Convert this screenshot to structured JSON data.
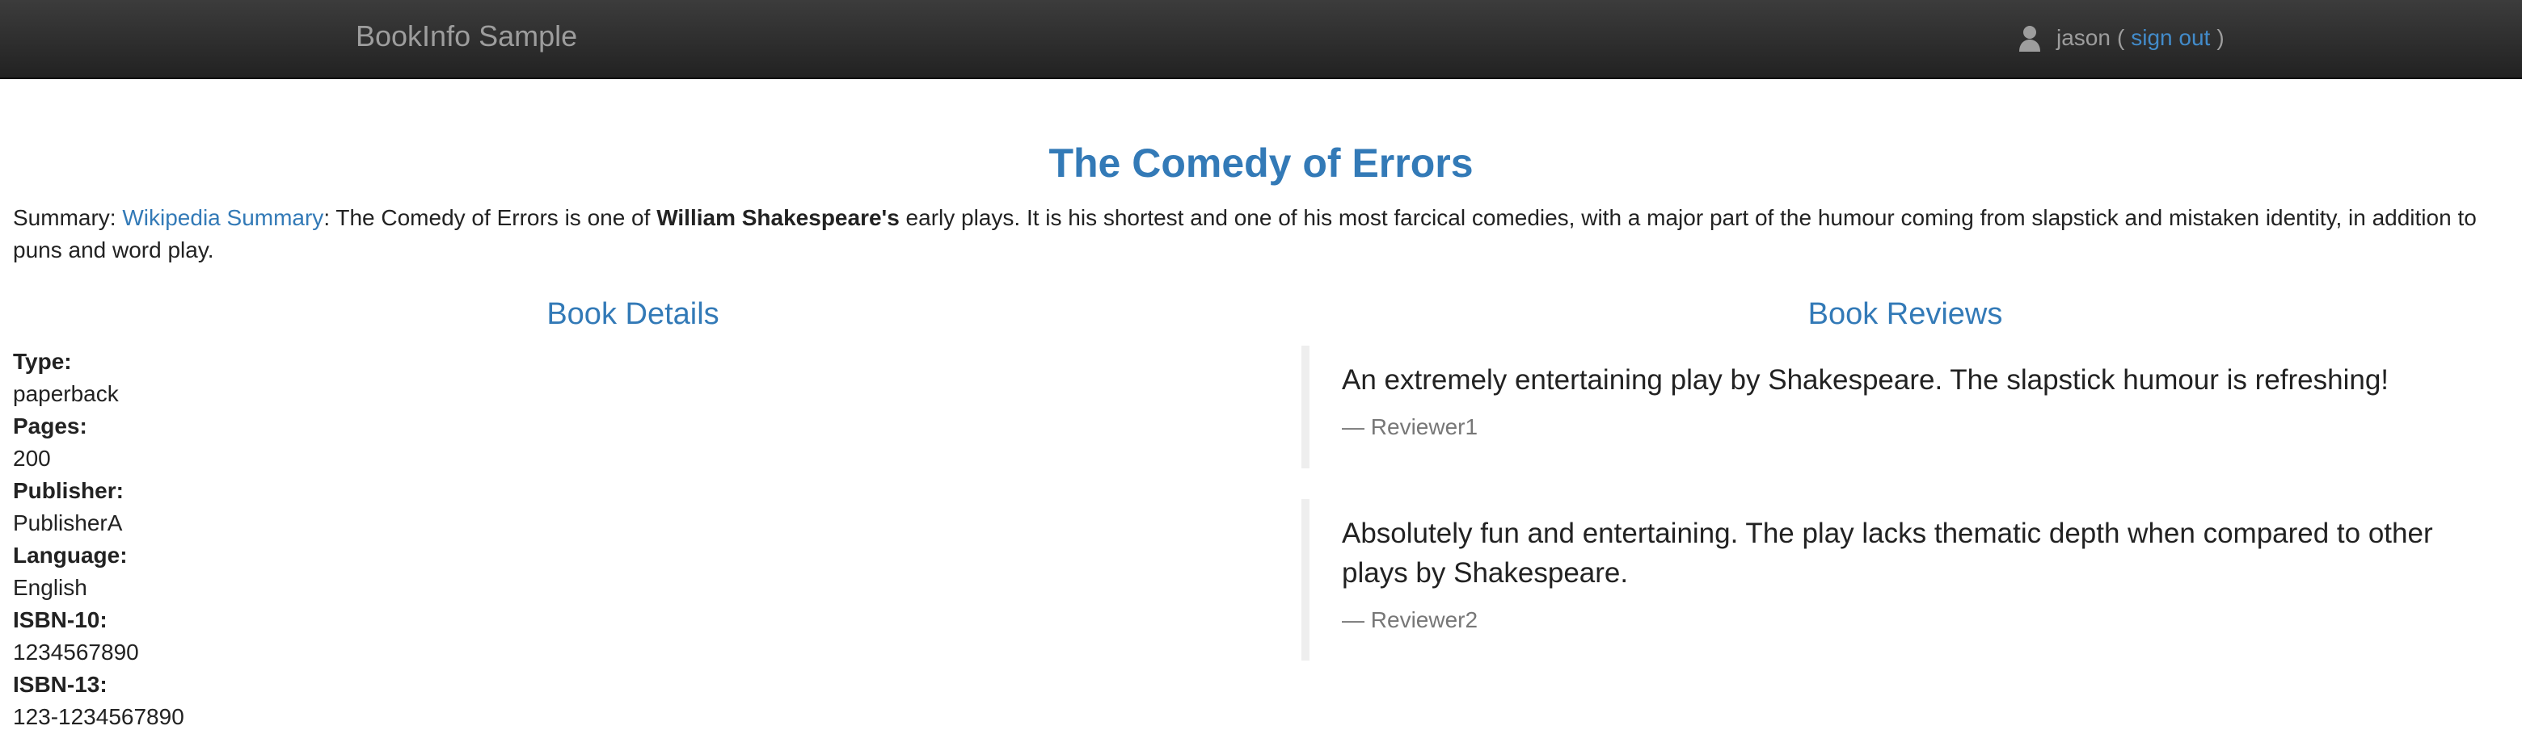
{
  "navbar": {
    "brand": "BookInfo Sample",
    "user_icon": "user-icon",
    "username": "jason",
    "open_paren": "(",
    "sign_out": "sign out",
    "close_paren": ")"
  },
  "book": {
    "title": "The Comedy of Errors",
    "summary": {
      "prefix": "Summary: ",
      "link_text": "Wikipedia Summary",
      "text_before_author": ": The Comedy of Errors is one of ",
      "author": "William Shakespeare's",
      "text_after_author": " early plays. It is his shortest and one of his most farcical comedies, with a major part of the humour coming from slapstick and mistaken identity, in addition to puns and word play."
    }
  },
  "details": {
    "heading": "Book Details",
    "items": [
      {
        "label": "Type:",
        "value": "paperback"
      },
      {
        "label": "Pages:",
        "value": "200"
      },
      {
        "label": "Publisher:",
        "value": "PublisherA"
      },
      {
        "label": "Language:",
        "value": "English"
      },
      {
        "label": "ISBN-10:",
        "value": "1234567890"
      },
      {
        "label": "ISBN-13:",
        "value": "123-1234567890"
      }
    ]
  },
  "reviews": {
    "heading": "Book Reviews",
    "items": [
      {
        "text": "An extremely entertaining play by Shakespeare. The slapstick humour is refreshing!",
        "author": "— Reviewer1"
      },
      {
        "text": "Absolutely fun and entertaining. The play lacks thematic depth when compared to other plays by Shakespeare.",
        "author": "— Reviewer2"
      }
    ]
  }
}
